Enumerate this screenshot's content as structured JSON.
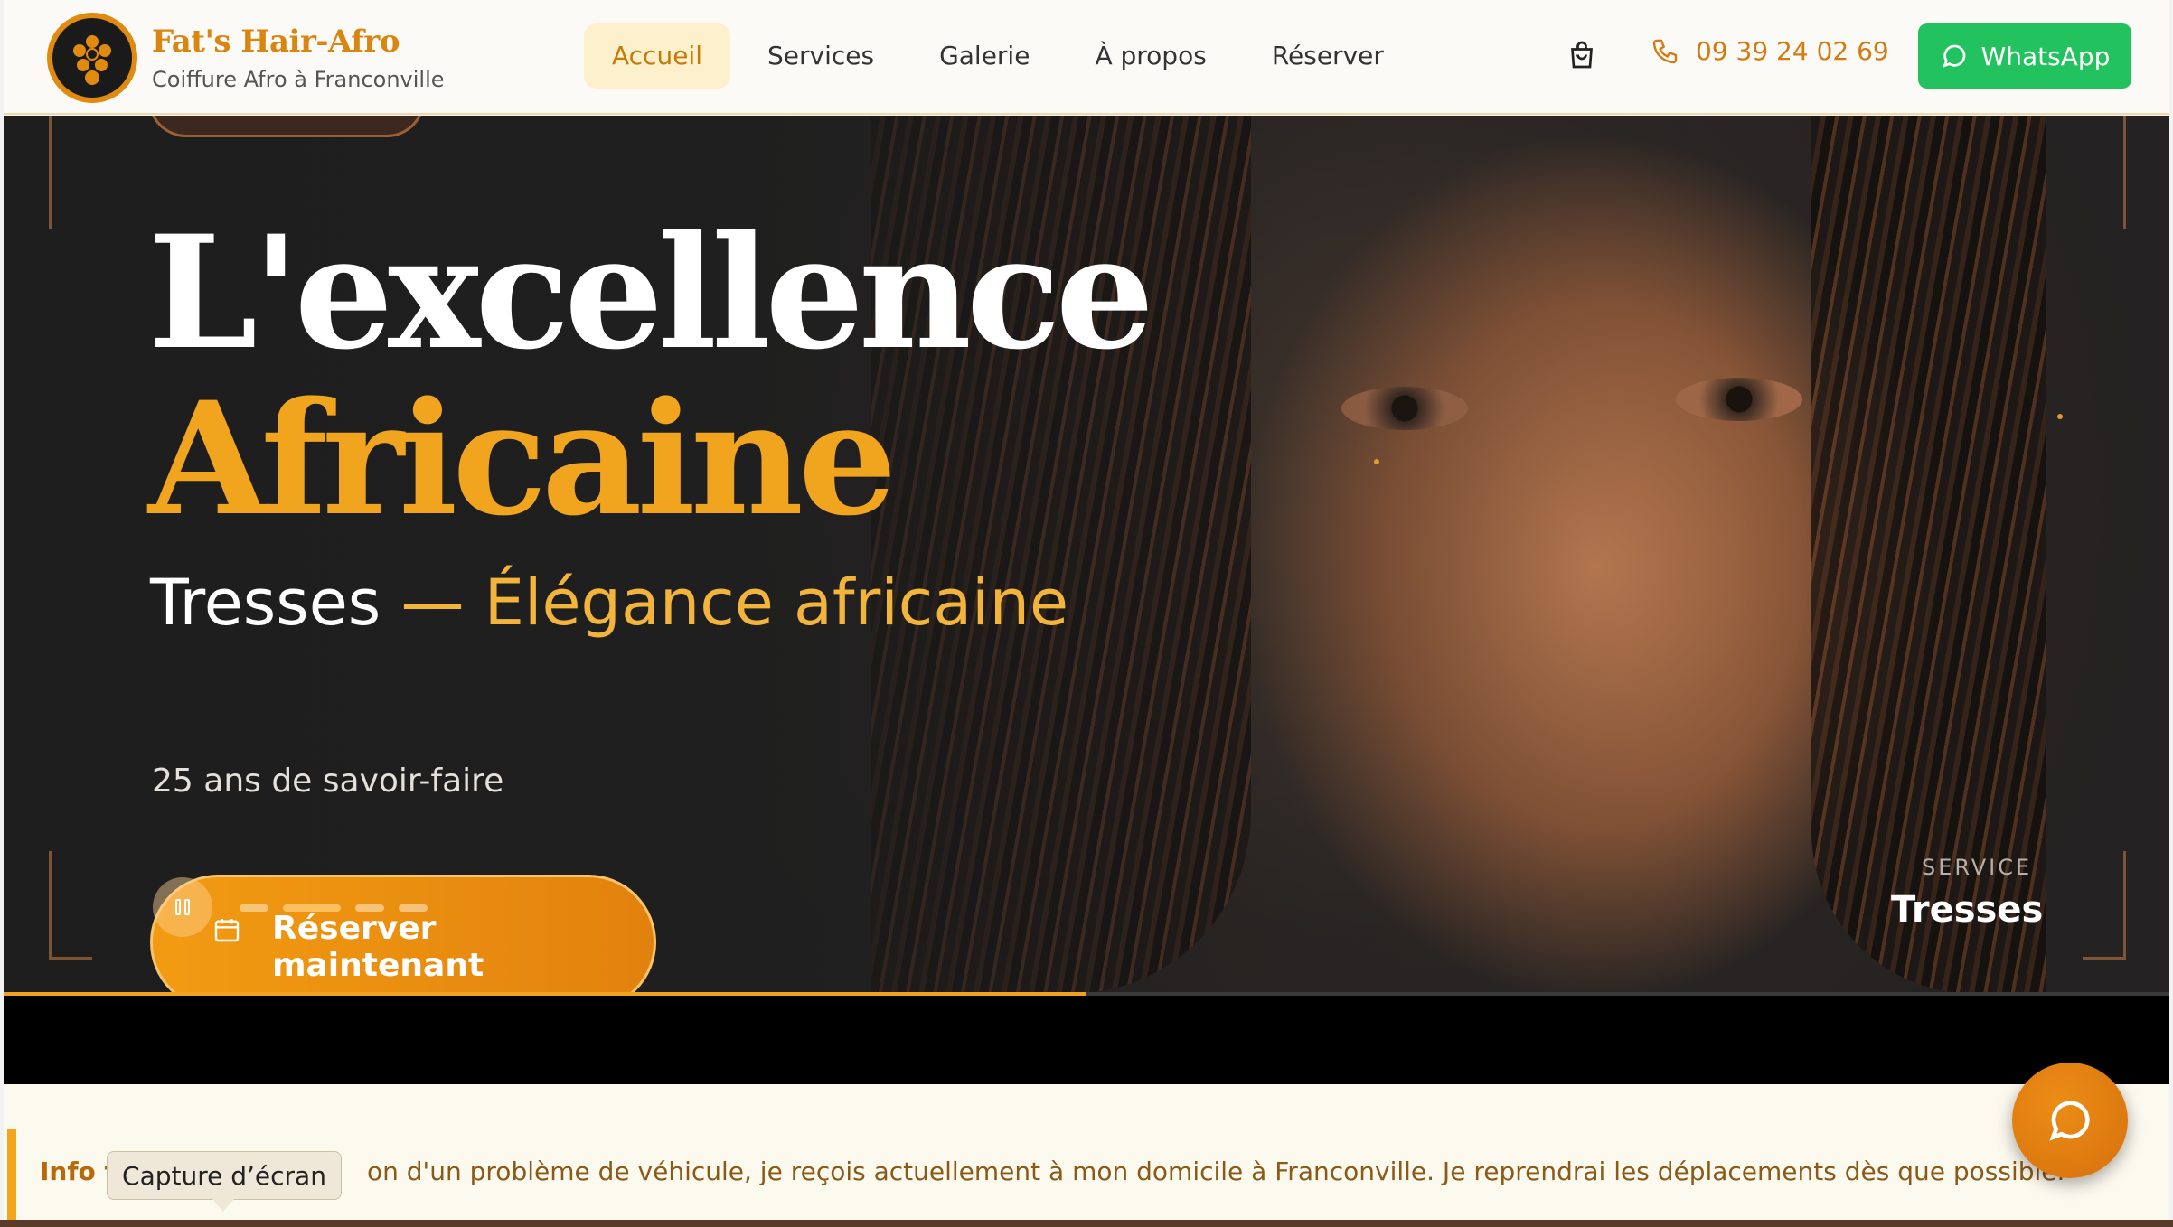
{
  "brand": {
    "name": "Fat's Hair-Afro",
    "tagline": "Coiffure Afro à Franconville",
    "logo_icon": "flower-logo-icon"
  },
  "nav": {
    "items": [
      {
        "label": "Accueil",
        "active": true
      },
      {
        "label": "Services",
        "active": false
      },
      {
        "label": "Galerie",
        "active": false
      },
      {
        "label": "À propos",
        "active": false
      },
      {
        "label": "Réserver",
        "active": false
      }
    ]
  },
  "header_actions": {
    "cart_icon": "shopping-bag-icon",
    "phone": "09 39 24 02 69",
    "whatsapp_label": "WhatsApp"
  },
  "hero": {
    "headline_line1": "L'excellence",
    "headline_line2": "Africaine",
    "subtitle_main": "Tresses",
    "subtitle_sep": " — ",
    "subtitle_accent": "Élégance africaine",
    "years": "25 ans de savoir-faire",
    "cta_label": "Réserver maintenant",
    "service_label": "SERVICE",
    "service_value": "Tresses",
    "slides_total": 4,
    "slide_active": 1,
    "progress": 0.5
  },
  "info": {
    "title": "Info t",
    "text": "on d'un problème de véhicule, je reçois actuellement à mon domicile à Franconville. Je reprendrai les déplacements dès que possible."
  },
  "tooltip": "Capture d’écran",
  "colors": {
    "accent": "#f1a51e",
    "accent_dark": "#d8860f",
    "whatsapp": "#22c35e",
    "info_bg": "#fcf9ef"
  }
}
